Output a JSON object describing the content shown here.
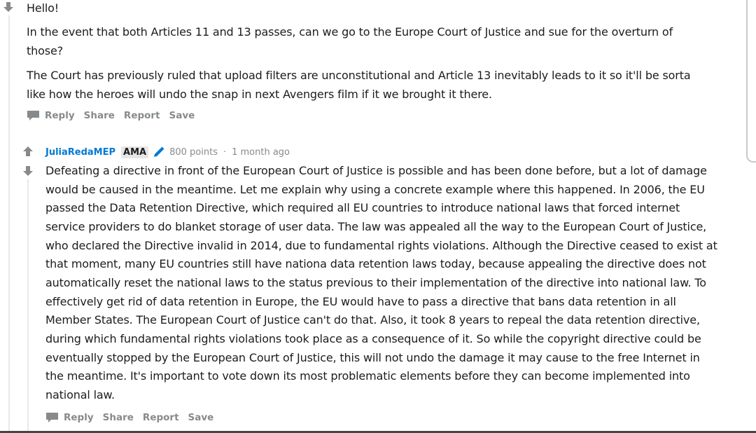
{
  "comment1": {
    "paragraphs": [
      "Hello!",
      "In the event that both Articles 11 and 13 passes, can we go to the Europe Court of Justice and sue for the overturn of",
      "those?",
      "The Court has previously ruled that upload filters are unconstitutional and Article 13 inevitably leads to it so it'll be sorta",
      "like how the heroes will undo the snap in next Avengers film if it we brought it there."
    ],
    "actions": [
      "Reply",
      "Share",
      "Report",
      "Save"
    ]
  },
  "comment2": {
    "author": "JuliaRedaMEP",
    "flair": "AMA",
    "points": "800 points",
    "separator": "·",
    "time": "1 month ago",
    "lines": [
      "Defeating a directive in front of the European Court of Justice is possible and has been done before, but a lot of damage",
      "would be caused in the meantime. Let me explain why using a concrete example where this happened. In 2006, the EU",
      "passed the Data Retention Directive, which required all EU countries to introduce national laws that forced internet",
      "service providers to do blanket storage of user data. The law was appealed all the way to the European Court of Justice,",
      "who declared the Directive invalid in 2014, due to fundamental rights violations. Although the Directive ceased to exist at",
      "that moment, many EU countries still have nationa data retention laws today, because appealing the directive does not",
      "automatically reset the national laws to the status previous to their implementation of the directive into national law. To",
      "effectively get rid of data retention in Europe, the EU would have to pass a directive that bans data retention in all",
      "Member States. The European Court of Justice can't do that. Also, it took 8 years to repeal the data retention directive,",
      "during which fundamental rights violations took place as a consequence of it. So while the copyright directive could be",
      "eventually stopped by the European Court of Justice, this will not undo the damage it may cause to the free Internet in",
      "the meantime. It's important to vote down its most problematic elements before they can become implemented into",
      "national law."
    ],
    "actions": [
      "Reply",
      "Share",
      "Report",
      "Save"
    ]
  },
  "icons": {
    "upvote": "upvote-arrow-icon",
    "downvote": "downvote-arrow-icon",
    "mod_badge": "pencil-icon",
    "reply": "chat-bubble-icon"
  },
  "colors": {
    "author": "#0079d3",
    "muted": "#878a8c",
    "arrow": "#878a8c",
    "badge_bg": "#e6e6e6"
  }
}
